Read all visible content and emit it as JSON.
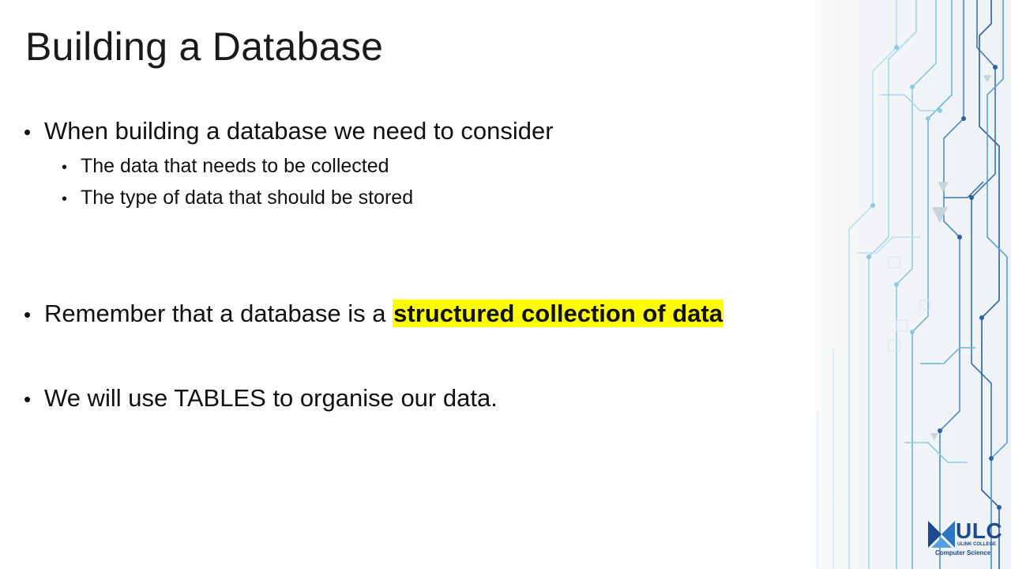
{
  "slide": {
    "title": "Building a Database",
    "bullets": [
      {
        "text": "When building  a database we need to consider",
        "sub": [
          "The data that needs to be collected",
          "The type of data that should be stored"
        ]
      },
      {
        "text_before": "Remember that a database is a ",
        "highlight": "structured collection of data"
      },
      {
        "text": "We will use TABLES to organise  our data."
      }
    ]
  },
  "logo": {
    "name": "ULC",
    "org": "ULINK COLLEGE",
    "dept": "Computer Science"
  },
  "colors": {
    "highlight": "#ffff00",
    "circuit_light": "#9ad3e6",
    "circuit_dark": "#2d5fa3",
    "logo_blue": "#1c4a8e"
  }
}
